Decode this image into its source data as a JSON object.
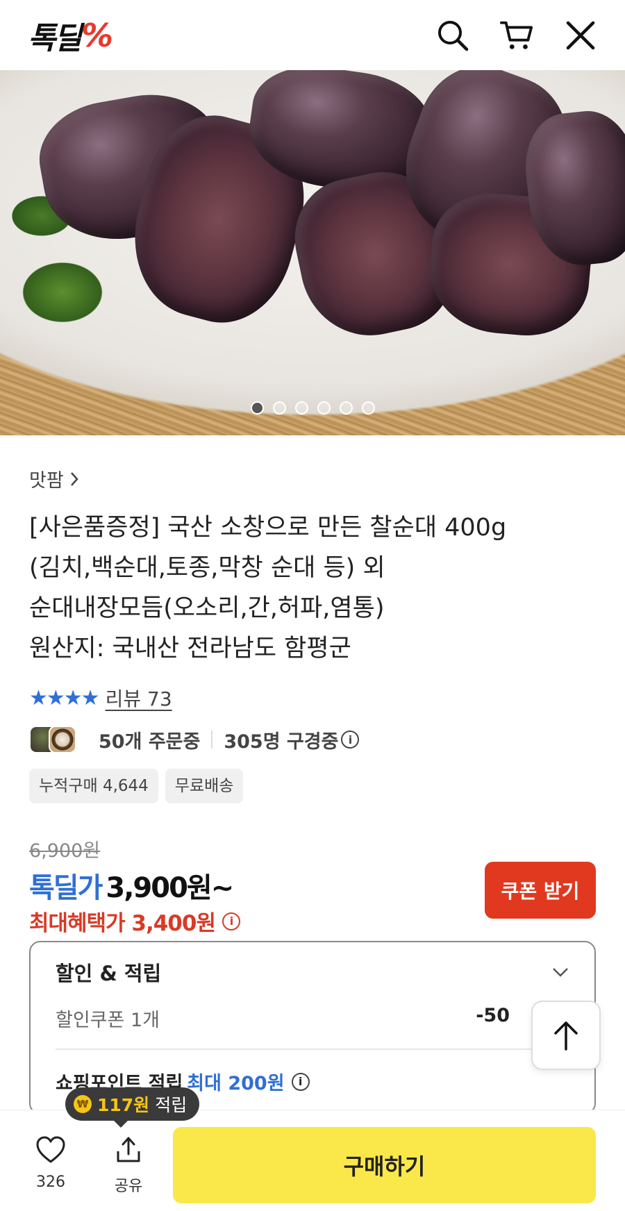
{
  "header": {
    "logo_text": "톡딜",
    "logo_mark": "%"
  },
  "gallery": {
    "image_count": 6,
    "active_index": 0
  },
  "product": {
    "shop_name": "맛팜",
    "title_lines": [
      "[사은품증정] 국산 소창으로 만든 찰순대 400g",
      "(김치,백순대,토종,막창 순대 등) 외",
      "순대내장모듬(오소리,간,허파,염통)",
      "원산지: 국내산 전라남도 함평군"
    ],
    "rating_stars": 4,
    "review_label": "리뷰 73",
    "ordering_text": "50개 주문중",
    "browsing_text": "305명 구경중",
    "badges": [
      "누적구매 4,644",
      "무료배송"
    ]
  },
  "price": {
    "original": "6,900원",
    "deal_label": "톡딜가",
    "deal_price": "3,900원~",
    "max_benefit_label": "최대혜택가 3,400원",
    "coupon_button": "쿠폰 받기"
  },
  "discount_box": {
    "title": "할인 & 적립",
    "coupon_label": "할인쿠폰 1개",
    "coupon_amount": "-50",
    "point_label": "쇼핑포인트 적립",
    "point_value": "최대 200원"
  },
  "bottom_bar": {
    "tooltip_amount": "117원",
    "tooltip_suffix": "적립",
    "coin_symbol": "₩",
    "like_count": "326",
    "share_label": "공유",
    "buy_label": "구매하기"
  },
  "colors": {
    "accent_blue": "#2f6fd6",
    "accent_red": "#e0391f",
    "buy_yellow": "#fae84a",
    "logo_red": "#e8392e"
  }
}
